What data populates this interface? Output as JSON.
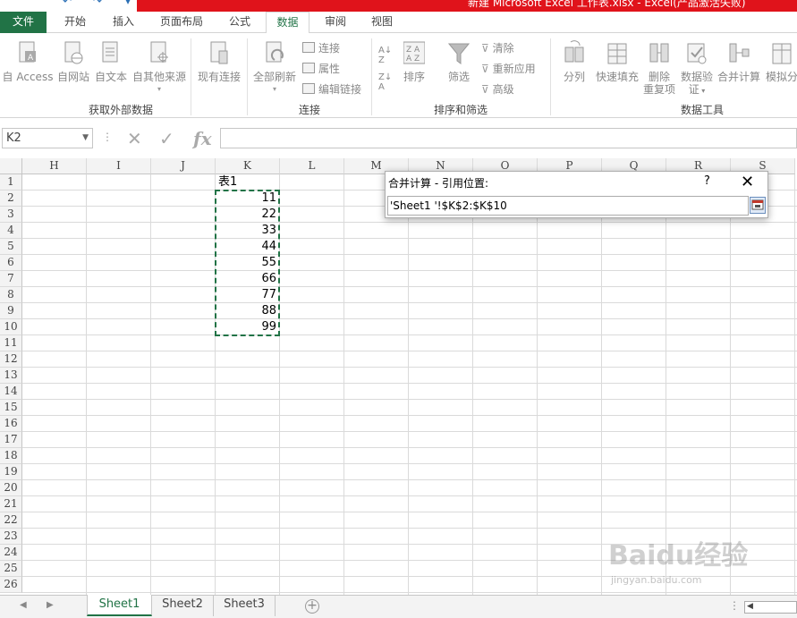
{
  "window": {
    "title": "新建 Microsoft Excel 工作表.xlsx - Excel(产品激活失败)"
  },
  "ribbon_tabs": [
    {
      "label": "文件"
    },
    {
      "label": "开始"
    },
    {
      "label": "插入"
    },
    {
      "label": "页面布局"
    },
    {
      "label": "公式"
    },
    {
      "label": "数据"
    },
    {
      "label": "审阅"
    },
    {
      "label": "视图"
    }
  ],
  "active_tab": "数据",
  "ribbon": {
    "external": {
      "buttons": [
        "自 Access",
        "自网站",
        "自文本",
        "自其他来源"
      ],
      "existing": "现有连接",
      "label": "获取外部数据"
    },
    "connections": {
      "refresh_all": "全部刷新",
      "items": [
        "连接",
        "属性",
        "编辑链接"
      ],
      "label": "连接"
    },
    "sort_filter": {
      "sort": "排序",
      "filter": "筛选",
      "items": [
        "清除",
        "重新应用",
        "高级"
      ],
      "label": "排序和筛选"
    },
    "data_tools": {
      "text_to_columns": "分列",
      "flash_fill": "快速填充",
      "remove_duplicates": [
        "删除",
        "重复项"
      ],
      "validation": [
        "数据验",
        "证"
      ],
      "consolidate": "合并计算",
      "what_if": "模拟分",
      "label": "数据工具"
    }
  },
  "formula_bar": {
    "name_box": "K2",
    "fx": "fx",
    "formula": ""
  },
  "columns": [
    "H",
    "I",
    "J",
    "K",
    "L",
    "M",
    "N",
    "O",
    "P",
    "Q",
    "R",
    "S"
  ],
  "rows": [
    "1",
    "2",
    "3",
    "4",
    "5",
    "6",
    "7",
    "8",
    "9",
    "10",
    "11",
    "12",
    "13",
    "14",
    "15",
    "16",
    "17",
    "18",
    "19",
    "20",
    "21",
    "22",
    "23",
    "24",
    "25",
    "26"
  ],
  "cells": {
    "K1": "表1",
    "K_values": [
      "11",
      "22",
      "33",
      "44",
      "55",
      "66",
      "77",
      "88",
      "99"
    ]
  },
  "dialog": {
    "title": "合并计算 - 引用位置:",
    "help": "?",
    "close": "✕",
    "reference": "'Sheet1 '!$K$2:$K$10"
  },
  "sheets": [
    {
      "name": "Sheet1",
      "active": true
    },
    {
      "name": "Sheet2",
      "active": false
    },
    {
      "name": "Sheet3",
      "active": false
    }
  ],
  "watermark": {
    "text": "Baidu经验",
    "url": "jingyan.baidu.com"
  },
  "colors": {
    "excel_green": "#217346",
    "title_red": "#e0131b"
  }
}
